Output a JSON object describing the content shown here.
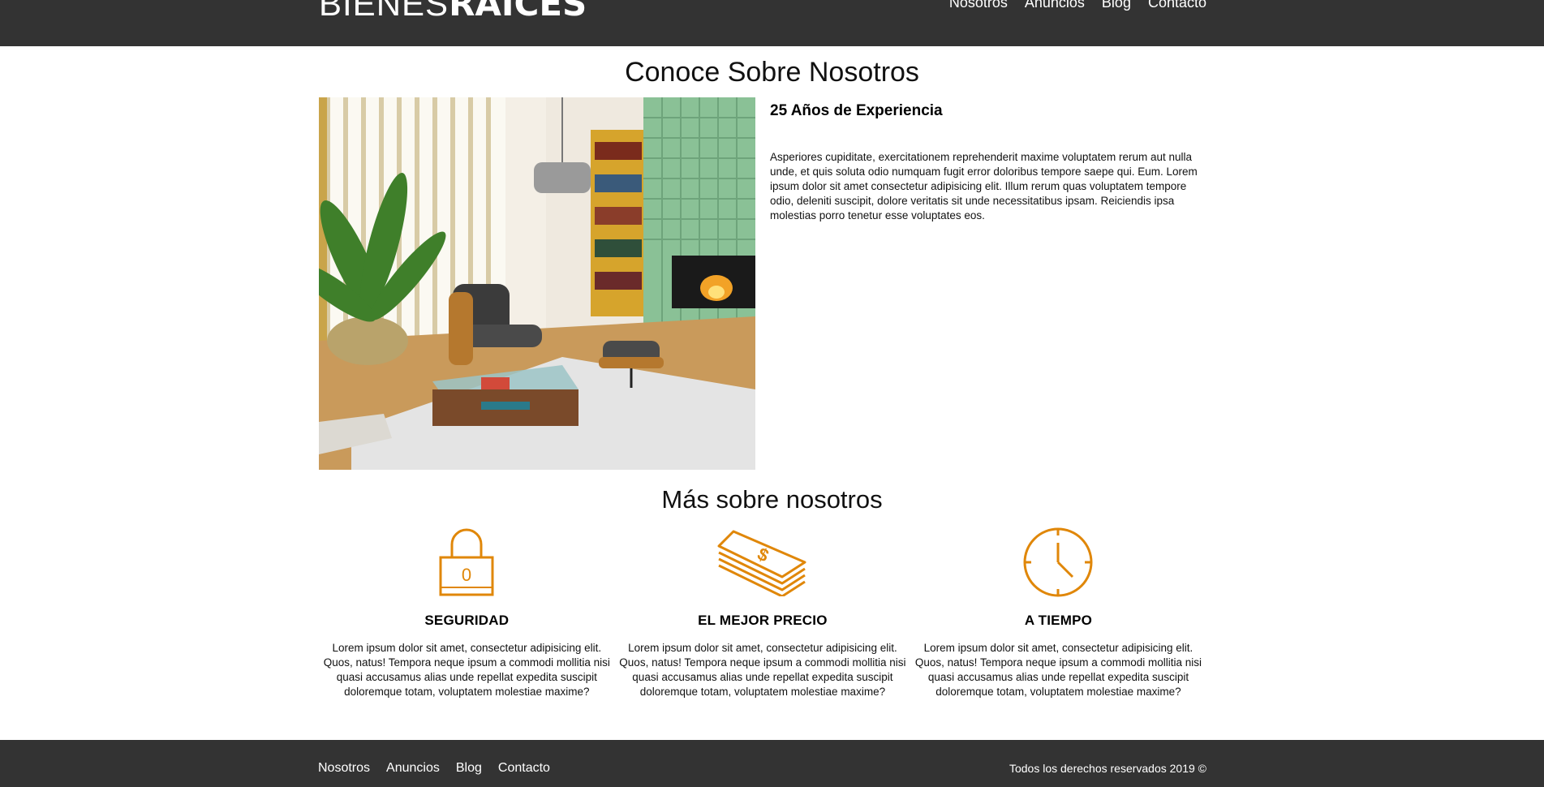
{
  "header": {
    "logo_thin": "BIENES",
    "logo_bold": "RAICES",
    "nav": [
      "Nosotros",
      "Anuncios",
      "Blog",
      "Contacto"
    ]
  },
  "about": {
    "title": "Conoce Sobre Nosotros",
    "image_alt": "living-room-photo",
    "heading": "25 Años de Experiencia",
    "text": "Asperiores cupiditate, exercitationem reprehenderit maxime voluptatem rerum aut nulla unde, et quis soluta odio numquam fugit error doloribus tempore saepe qui. Eum. Lorem ipsum dolor sit amet consectetur adipisicing elit. Illum rerum quas voluptatem tempore odio, deleniti suscipit, dolore veritatis sit unde necessitatibus ipsam. Reiciendis ipsa molestias porro tenetur esse voluptates eos."
  },
  "more": {
    "title": "Más sobre nosotros",
    "features": [
      {
        "icon": "lock-icon",
        "title": "SEGURIDAD",
        "text": "Lorem ipsum dolor sit amet, consectetur adipisicing elit. Quos, natus! Tempora neque ipsum a commodi mollitia nisi quasi accusamus alias unde repellat expedita suscipit doloremque totam, voluptatem molestiae maxime?"
      },
      {
        "icon": "money-icon",
        "title": "EL MEJOR PRECIO",
        "text": "Lorem ipsum dolor sit amet, consectetur adipisicing elit. Quos, natus! Tempora neque ipsum a commodi mollitia nisi quasi accusamus alias unde repellat expedita suscipit doloremque totam, voluptatem molestiae maxime?"
      },
      {
        "icon": "clock-icon",
        "title": "A TIEMPO",
        "text": "Lorem ipsum dolor sit amet, consectetur adipisicing elit. Quos, natus! Tempora neque ipsum a commodi mollitia nisi quasi accusamus alias unde repellat expedita suscipit doloremque totam, voluptatem molestiae maxime?"
      }
    ]
  },
  "footer": {
    "nav": [
      "Nosotros",
      "Anuncios",
      "Blog",
      "Contacto"
    ],
    "copyright": "Todos los derechos reservados 2019 ©"
  },
  "colors": {
    "header_bg": "#333333",
    "accent": "#e08709"
  }
}
